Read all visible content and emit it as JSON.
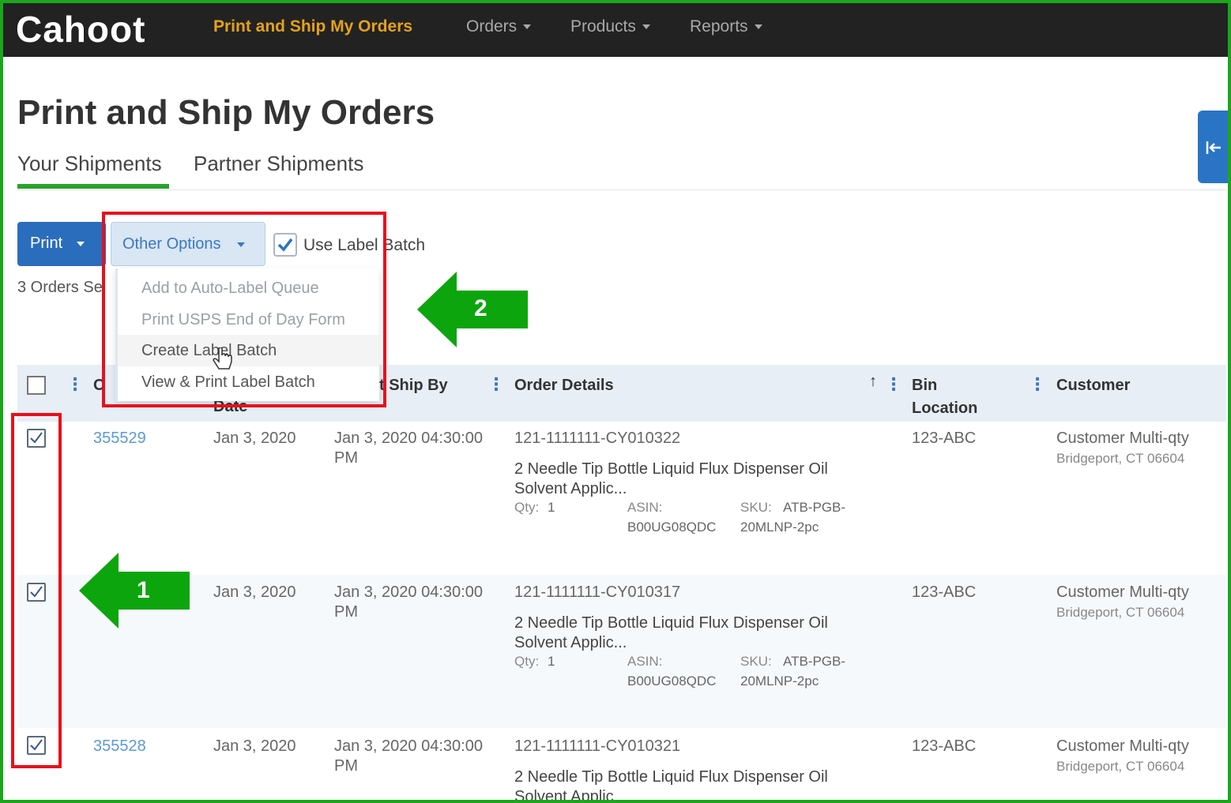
{
  "app": {
    "logo": "Cahoot"
  },
  "nav": {
    "active": "Print and Ship My Orders",
    "items": [
      "Orders",
      "Products",
      "Reports"
    ]
  },
  "page": {
    "title": "Print and Ship My Orders"
  },
  "tabs": [
    "Your Shipments",
    "Partner Shipments"
  ],
  "side_tab_icon": "collapse-left-icon",
  "toolbar": {
    "print_label": "Print",
    "other_options_label": "Other Options",
    "use_label_batch_label": "Use Label Batch",
    "use_label_batch_checked": true
  },
  "orders_selected_text": "3 Orders Se",
  "dropdown": {
    "items": [
      "Add to Auto-Label Queue",
      "Print USPS End of Day Form",
      "Create Label Batch",
      "View & Print Label Batch"
    ]
  },
  "annotations": {
    "arrow1_label": "1",
    "arrow2_label": "2",
    "arrow_color": "#0da50d",
    "box_color": "#e8101b"
  },
  "table": {
    "headers": {
      "order_partial": "O",
      "date_partial": "Date",
      "ship_by_partial": "t Ship By",
      "order_details": "Order Details",
      "bin_location_line1": "Bin",
      "bin_location_line2": "Location",
      "customer": "Customer"
    },
    "sort_icon": "↑",
    "rows": [
      {
        "checked": true,
        "order": "355529",
        "date": "Jan 3, 2020",
        "ship_by_line1": "Jan 3, 2020 04:30:00",
        "ship_by_line2": "PM",
        "order_id": "121-1111111-CY010322",
        "product_line1": "2 Needle Tip Bottle Liquid Flux Dispenser Oil",
        "product_line2": "Solvent Applic...",
        "qty_label": "Qty:",
        "qty": "1",
        "asin_label": "ASIN:",
        "asin": "B00UG08QDC",
        "sku_label": "SKU:",
        "sku_line1": "ATB-PGB-",
        "sku_line2": "20MLNP-2pc",
        "bin": "123-ABC",
        "customer_name": "Customer Multi-qty",
        "customer_city": "Bridgeport,",
        "customer_state": "CT",
        "customer_zip": "06604"
      },
      {
        "checked": true,
        "order": "",
        "date": "Jan 3, 2020",
        "ship_by_line1": "Jan 3, 2020 04:30:00",
        "ship_by_line2": "PM",
        "order_id": "121-1111111-CY010317",
        "product_line1": "2 Needle Tip Bottle Liquid Flux Dispenser Oil",
        "product_line2": "Solvent Applic...",
        "qty_label": "Qty:",
        "qty": "1",
        "asin_label": "ASIN:",
        "asin": "B00UG08QDC",
        "sku_label": "SKU:",
        "sku_line1": "ATB-PGB-",
        "sku_line2": "20MLNP-2pc",
        "bin": "123-ABC",
        "customer_name": "Customer Multi-qty",
        "customer_city": "Bridgeport,",
        "customer_state": "CT",
        "customer_zip": "06604"
      },
      {
        "checked": true,
        "order": "355528",
        "date": "Jan 3, 2020",
        "ship_by_line1": "Jan 3, 2020 04:30:00",
        "ship_by_line2": "PM",
        "order_id": "121-1111111-CY010321",
        "product_line1": "2 Needle Tip Bottle Liquid Flux Dispenser Oil",
        "product_line2": "Solvent Applic",
        "bin": "123-ABC",
        "customer_name": "Customer Multi-qty",
        "customer_city": "Bridgeport,",
        "customer_state": "CT",
        "customer_zip": "06604"
      }
    ]
  }
}
